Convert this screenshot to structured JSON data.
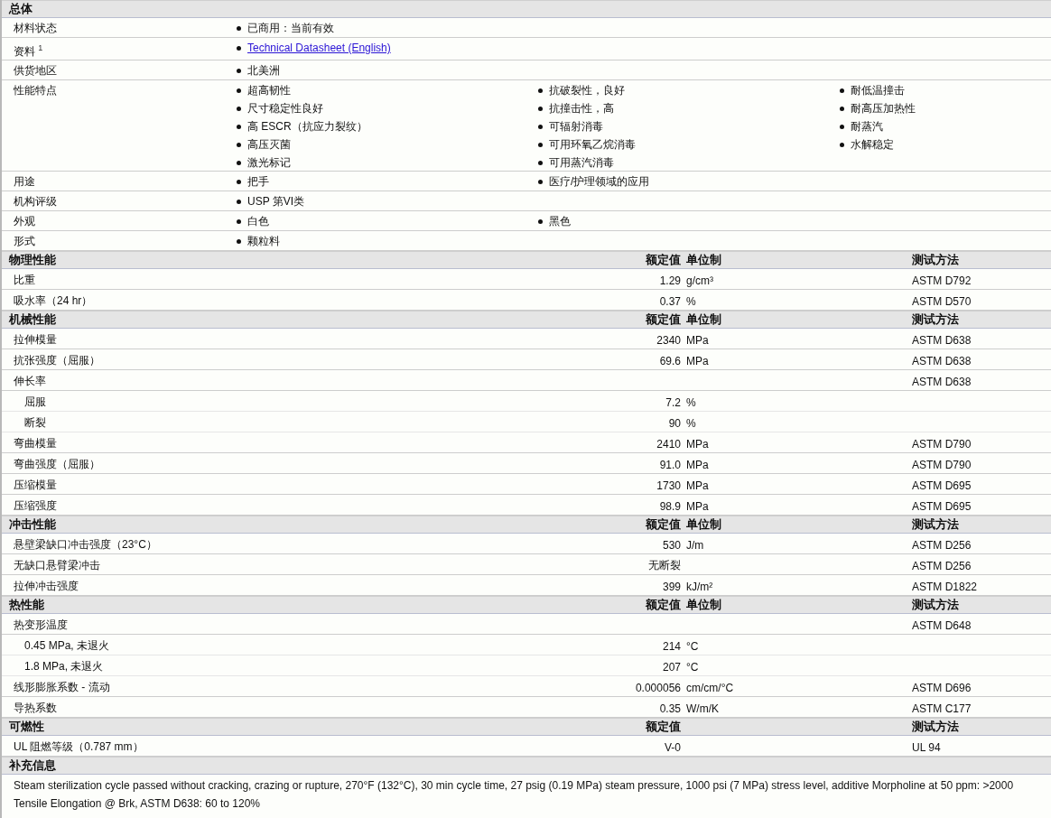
{
  "general": {
    "title": "总体",
    "rows": [
      {
        "label": "材料状态",
        "columns": [
          [
            {
              "text": "已商用：当前有效",
              "kind": "text"
            }
          ]
        ]
      },
      {
        "label": "资料 $^{1}$",
        "columns": [
          [
            {
              "text": "Technical Datasheet (English)",
              "kind": "link"
            }
          ]
        ]
      },
      {
        "label": "供货地区",
        "columns": [
          [
            {
              "text": "北美洲",
              "kind": "text"
            }
          ]
        ]
      },
      {
        "label": "性能特点",
        "columns": [
          [
            {
              "text": "超高韧性",
              "kind": "text"
            },
            {
              "text": "尺寸稳定性良好",
              "kind": "text"
            },
            {
              "text": "高  ESCR（抗应力裂纹）",
              "kind": "text"
            },
            {
              "text": "高压灭菌",
              "kind": "text"
            },
            {
              "text": "激光标记",
              "kind": "text"
            }
          ],
          [
            {
              "text": "抗破裂性，良好",
              "kind": "text"
            },
            {
              "text": "抗撞击性，高",
              "kind": "text"
            },
            {
              "text": "可辐射消毒",
              "kind": "text"
            },
            {
              "text": "可用环氧乙烷消毒",
              "kind": "text"
            },
            {
              "text": "可用蒸汽消毒",
              "kind": "text"
            }
          ],
          [
            {
              "text": "耐低温撞击",
              "kind": "text"
            },
            {
              "text": "耐高压加热性",
              "kind": "text"
            },
            {
              "text": "耐蒸汽",
              "kind": "text"
            },
            {
              "text": "水解稳定",
              "kind": "text"
            }
          ]
        ]
      },
      {
        "label": "用途",
        "columns": [
          [
            {
              "text": "把手",
              "kind": "text"
            }
          ],
          [
            {
              "text": "医疗/护理领域的应用",
              "kind": "text"
            }
          ]
        ]
      },
      {
        "label": "机构评级",
        "columns": [
          [
            {
              "text": "USP 第VI类",
              "kind": "text"
            }
          ]
        ]
      },
      {
        "label": "外观",
        "columns": [
          [
            {
              "text": "白色",
              "kind": "text"
            }
          ],
          [
            {
              "text": "黑色",
              "kind": "text"
            }
          ]
        ]
      },
      {
        "label": "形式",
        "columns": [
          [
            {
              "text": "颗粒料",
              "kind": "text"
            }
          ]
        ]
      }
    ]
  },
  "sections": [
    {
      "title": "物理性能",
      "value_header": "额定值",
      "unit_header": "单位制",
      "method_header": "测试方法",
      "rows": [
        {
          "label": "比重",
          "indented": false,
          "value": "1.29",
          "unit": "g/cm³",
          "method": "ASTM D792"
        },
        {
          "label": "吸水率（24 hr）",
          "indented": false,
          "value": "0.37",
          "unit": "%",
          "method": "ASTM D570"
        }
      ]
    },
    {
      "title": "机械性能",
      "value_header": "额定值",
      "unit_header": "单位制",
      "method_header": "测试方法",
      "rows": [
        {
          "label": "拉伸模量",
          "indented": false,
          "value": "2340",
          "unit": "MPa",
          "method": "ASTM D638"
        },
        {
          "label": "抗张强度（屈服）",
          "indented": false,
          "value": "69.6",
          "unit": "MPa",
          "method": "ASTM D638"
        },
        {
          "label": "伸长率",
          "indented": false,
          "method": "ASTM D638"
        },
        {
          "label": "屈服",
          "indented": true,
          "value": "7.2",
          "unit": "%"
        },
        {
          "label": "断裂",
          "indented": true,
          "value": "90",
          "unit": "%"
        },
        {
          "label": "弯曲模量",
          "indented": false,
          "value": "2410",
          "unit": "MPa",
          "method": "ASTM D790"
        },
        {
          "label": "弯曲强度（屈服）",
          "indented": false,
          "value": "91.0",
          "unit": "MPa",
          "method": "ASTM D790"
        },
        {
          "label": "压缩模量",
          "indented": false,
          "value": "1730",
          "unit": "MPa",
          "method": "ASTM D695"
        },
        {
          "label": "压缩强度",
          "indented": false,
          "value": "98.9",
          "unit": "MPa",
          "method": "ASTM D695"
        }
      ]
    },
    {
      "title": "冲击性能",
      "value_header": "额定值",
      "unit_header": "单位制",
      "method_header": "测试方法",
      "rows": [
        {
          "label": "悬壁梁缺口冲击强度（23°C）",
          "indented": false,
          "value": "530",
          "unit": "J/m",
          "method": "ASTM D256"
        },
        {
          "label": "无缺口悬臂梁冲击",
          "indented": false,
          "value": "无断裂",
          "method": "ASTM D256"
        },
        {
          "label": "拉伸冲击强度",
          "indented": false,
          "value": "399",
          "unit": "kJ/m²",
          "method": "ASTM D1822"
        }
      ]
    },
    {
      "title": "热性能",
      "value_header": "额定值",
      "unit_header": "单位制",
      "method_header": "测试方法",
      "rows": [
        {
          "label": "热变形温度",
          "indented": false,
          "method": "ASTM D648"
        },
        {
          "label": "0.45 MPa, 未退火",
          "indented": true,
          "value": "214",
          "unit": "°C"
        },
        {
          "label": "1.8 MPa, 未退火",
          "indented": true,
          "value": "207",
          "unit": "°C"
        },
        {
          "label": "线形膨胀系数  - 流动",
          "indented": false,
          "value": "0.000056",
          "unit": "cm/cm/°C",
          "method": "ASTM D696"
        },
        {
          "label": "导热系数",
          "indented": false,
          "value": "0.35",
          "unit": "W/m/K",
          "method": "ASTM C177"
        }
      ]
    },
    {
      "title": "可燃性",
      "value_header": "额定值",
      "method_header": "测试方法",
      "rows": [
        {
          "label": "UL 阻燃等级（0.787 mm）",
          "indented": false,
          "value": "V-0",
          "method": "UL 94"
        }
      ]
    }
  ],
  "notes": {
    "title": "补充信息",
    "lines": [
      "Steam sterilization cycle passed without cracking, crazing or rupture, 270°F (132°C), 30 min cycle time, 27 psig (0.19 MPa) steam pressure, 1000 psi (7 MPa) stress level, additive Morpholine at 50 ppm: >2000",
      "Tensile Elongation @ Brk, ASTM D638: 60 to 120%"
    ]
  }
}
